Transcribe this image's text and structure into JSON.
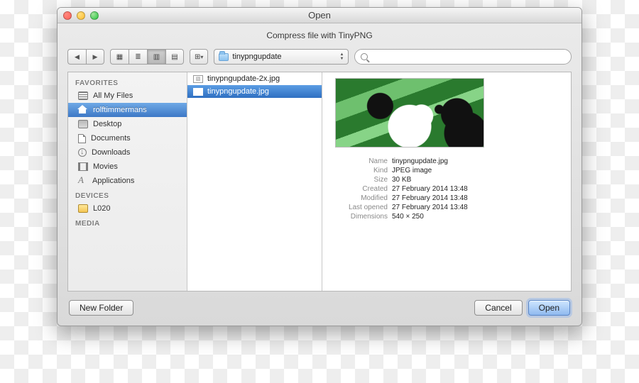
{
  "window": {
    "title": "Open",
    "subtitle": "Compress file with TinyPNG"
  },
  "toolbar": {
    "path_label": "tinypngupdate",
    "search_placeholder": ""
  },
  "sidebar": {
    "sections": [
      {
        "header": "FAVORITES",
        "items": [
          {
            "label": "All My Files"
          },
          {
            "label": "rolftimmermans",
            "selected": true
          },
          {
            "label": "Desktop"
          },
          {
            "label": "Documents"
          },
          {
            "label": "Downloads"
          },
          {
            "label": "Movies"
          },
          {
            "label": "Applications"
          }
        ]
      },
      {
        "header": "DEVICES",
        "items": [
          {
            "label": "L020"
          }
        ]
      },
      {
        "header": "MEDIA",
        "items": []
      }
    ]
  },
  "files": [
    {
      "name": "tinypngupdate-2x.jpg"
    },
    {
      "name": "tinypngupdate.jpg",
      "selected": true
    }
  ],
  "preview": {
    "fields": [
      {
        "k": "Name",
        "v": "tinypngupdate.jpg"
      },
      {
        "k": "Kind",
        "v": "JPEG image"
      },
      {
        "k": "Size",
        "v": "30 KB"
      },
      {
        "k": "Created",
        "v": "27 February 2014 13:48"
      },
      {
        "k": "Modified",
        "v": "27 February 2014 13:48"
      },
      {
        "k": "Last opened",
        "v": "27 February 2014 13:48"
      },
      {
        "k": "Dimensions",
        "v": "540 × 250"
      }
    ]
  },
  "footer": {
    "new_folder": "New Folder",
    "cancel": "Cancel",
    "open": "Open"
  }
}
